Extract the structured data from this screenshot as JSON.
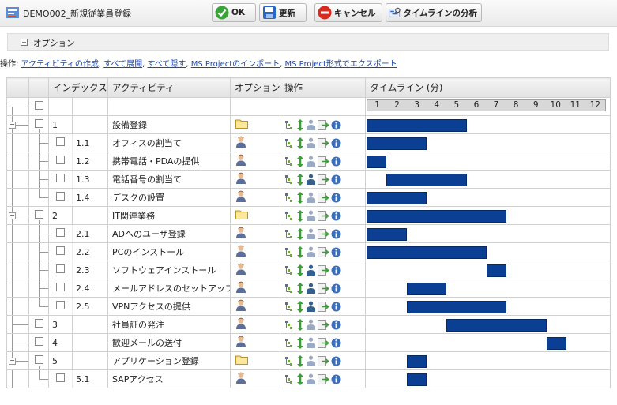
{
  "header": {
    "title": "DEMO002_新規従業員登録"
  },
  "toolbar": {
    "ok_label": "OK",
    "update_label": "更新",
    "cancel_label": "キャンセル",
    "analyze_label": "タイムラインの分析"
  },
  "options": {
    "label": "オプション"
  },
  "operations": {
    "prefix": "操作:",
    "links": [
      "アクティビティの作成",
      "すべて展開",
      "すべて隠す",
      "MS Projectのインポート",
      "MS Project形式でエクスポート"
    ]
  },
  "grid": {
    "headers": [
      "インデックス",
      "アクティビティ",
      "オプション",
      "操作",
      "タイムライン (分)"
    ],
    "timeline_ticks": [
      "1",
      "2",
      "3",
      "4",
      "5",
      "6",
      "7",
      "8",
      "9",
      "10",
      "11",
      "12"
    ],
    "timeline_max": 12,
    "rows": [
      {
        "index": "1",
        "activity": "設備登録",
        "level": 0,
        "option": "folder",
        "start": 0,
        "end": 5
      },
      {
        "index": "1.1",
        "activity": "オフィスの割当て",
        "level": 1,
        "option": "user",
        "start": 0,
        "end": 3
      },
      {
        "index": "1.2",
        "activity": "携帯電話・PDAの提供",
        "level": 1,
        "option": "user",
        "start": 0,
        "end": 1
      },
      {
        "index": "1.3",
        "activity": "電話番号の割当て",
        "level": 1,
        "option": "user",
        "start": 1,
        "end": 5
      },
      {
        "index": "1.4",
        "activity": "デスクの設置",
        "level": 1,
        "option": "user",
        "start": 0,
        "end": 3
      },
      {
        "index": "2",
        "activity": "IT関連業務",
        "level": 0,
        "option": "folder",
        "start": 0,
        "end": 7
      },
      {
        "index": "2.1",
        "activity": "ADへのユーザ登録",
        "level": 1,
        "option": "user",
        "start": 0,
        "end": 2
      },
      {
        "index": "2.2",
        "activity": "PCのインストール",
        "level": 1,
        "option": "user",
        "start": 0,
        "end": 6
      },
      {
        "index": "2.3",
        "activity": "ソフトウェアインストール",
        "level": 1,
        "option": "user",
        "start": 6,
        "end": 7
      },
      {
        "index": "2.4",
        "activity": "メールアドレスのセットアップ",
        "level": 1,
        "option": "user",
        "start": 2,
        "end": 4
      },
      {
        "index": "2.5",
        "activity": "VPNアクセスの提供",
        "level": 1,
        "option": "user",
        "start": 2,
        "end": 7
      },
      {
        "index": "3",
        "activity": "社員証の発注",
        "level": 0,
        "option": "user",
        "start": 4,
        "end": 9
      },
      {
        "index": "4",
        "activity": "歓迎メールの送付",
        "level": 0,
        "option": "user",
        "start": 9,
        "end": 10
      },
      {
        "index": "5",
        "activity": "アプリケーション登録",
        "level": 0,
        "option": "folder",
        "start": 2,
        "end": 3
      },
      {
        "index": "5.1",
        "activity": "SAPアクセス",
        "level": 1,
        "option": "user",
        "start": 2,
        "end": 3
      }
    ]
  },
  "colors": {
    "bar": "#0b3f94",
    "link": "#1a47b8"
  },
  "icons": {
    "folder": "folder-icon",
    "user": "user-icon",
    "ops": [
      "add-child-icon",
      "move-icon",
      "assign-icon",
      "export-icon",
      "info-icon"
    ]
  }
}
